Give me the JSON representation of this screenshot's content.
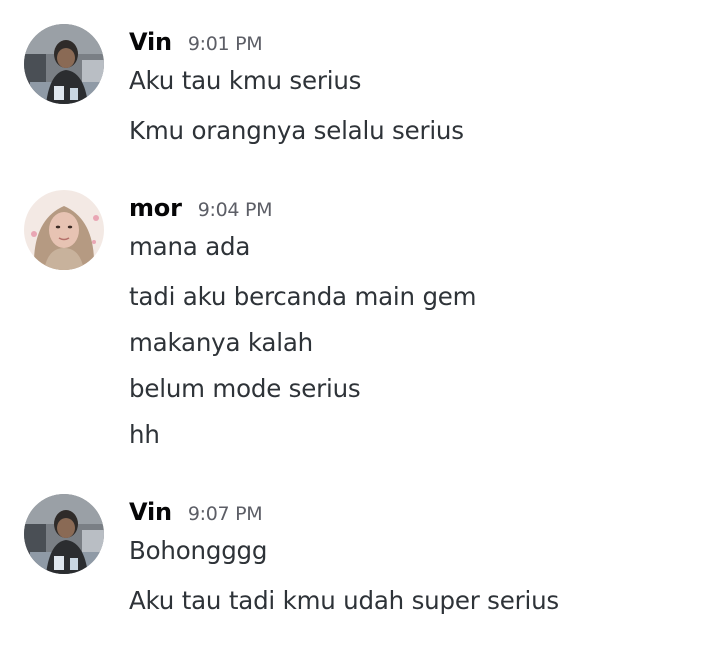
{
  "groups": [
    {
      "author": "Vin",
      "time": "9:01 PM",
      "messages": [
        "Aku tau kmu serius",
        "Kmu orangnya selalu serius"
      ]
    },
    {
      "author": "mor",
      "time": "9:04 PM",
      "messages": [
        "mana ada",
        "tadi aku bercanda main gem",
        "makanya kalah",
        "belum mode serius",
        "hh"
      ]
    },
    {
      "author": "Vin",
      "time": "9:07 PM",
      "messages": [
        "Bohongggg",
        "Aku tau tadi kmu udah super serius"
      ]
    }
  ]
}
